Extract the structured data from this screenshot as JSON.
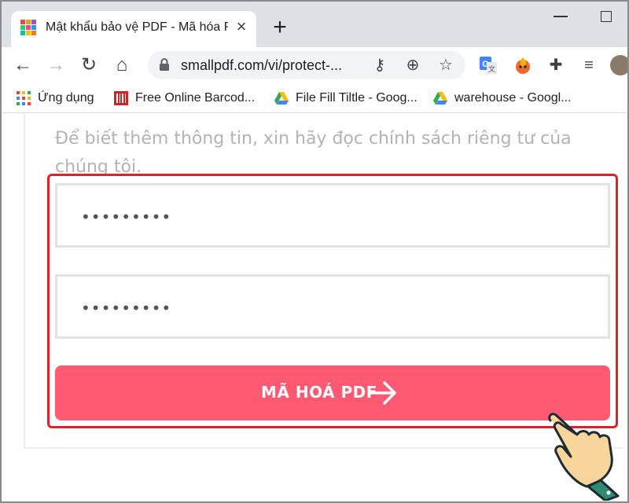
{
  "browser": {
    "tab": {
      "title": "Mật khẩu bảo vệ PDF - Mã hóa P"
    },
    "address": {
      "url": "smallpdf.com/vi/protect-..."
    },
    "bookmarks": [
      {
        "label": "Ứng dụng",
        "icon": "apps-grid-icon"
      },
      {
        "label": "Free Online Barcod...",
        "icon": "barcode-site-icon"
      },
      {
        "label": "File Fill Tiltle - Goog...",
        "icon": "google-drive-icon"
      },
      {
        "label": "warehouse - Googl...",
        "icon": "google-drive-icon"
      }
    ],
    "icons": {
      "back": "back-arrow-icon",
      "forward": "forward-arrow-icon",
      "reload": "reload-icon",
      "home": "home-icon",
      "key": "key-icon",
      "zoom": "zoom-icon",
      "star": "star-icon",
      "translate": "google-translate-icon",
      "hola": "fire-extension-icon",
      "extensions": "puzzle-icon",
      "media": "media-queue-icon"
    }
  },
  "page": {
    "privacy_text": "Để biết thêm thông tin, xin hãy đọc chính sách riêng tư của chúng tôi.",
    "password": {
      "value": "•••••••••"
    },
    "confirm_password": {
      "value": "•••••••••"
    },
    "encrypt_button": {
      "label": "MÃ HOÁ PDF"
    }
  },
  "colors": {
    "accent": "#ff5a72",
    "highlight": "#d9232e",
    "text_muted": "#b3b3b3"
  }
}
